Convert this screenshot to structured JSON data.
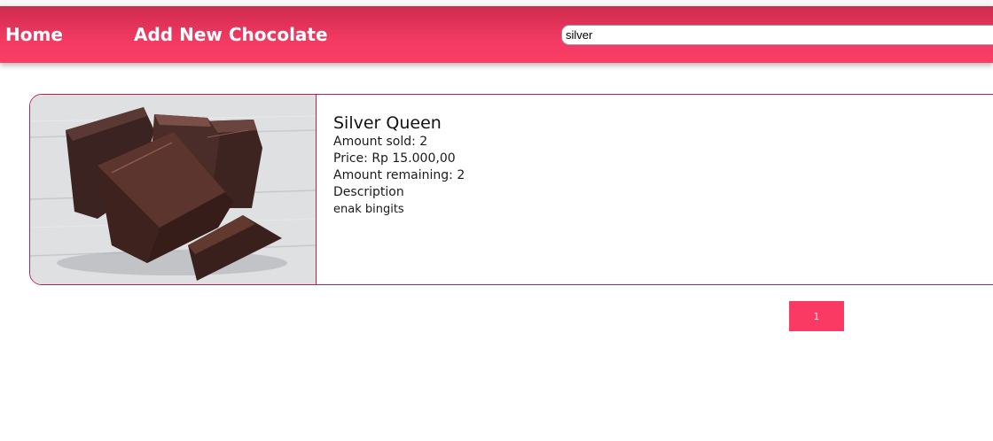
{
  "nav": {
    "home_label": "Home",
    "add_label": "Add New Chocolate"
  },
  "search": {
    "value": "silver"
  },
  "product": {
    "name": "Silver Queen",
    "amount_sold": "Amount sold: 2",
    "price": "Price: Rp 15.000,00",
    "amount_remaining": "Amount remaining: 2",
    "description_label": "Description",
    "description": "enak bingits",
    "image_icon": "chocolate-image"
  },
  "pagination": {
    "pages": [
      "1"
    ]
  },
  "colors": {
    "accent": "#fb3a64",
    "nav_top": "#cf2a4f",
    "card_border": "#b0254b"
  }
}
